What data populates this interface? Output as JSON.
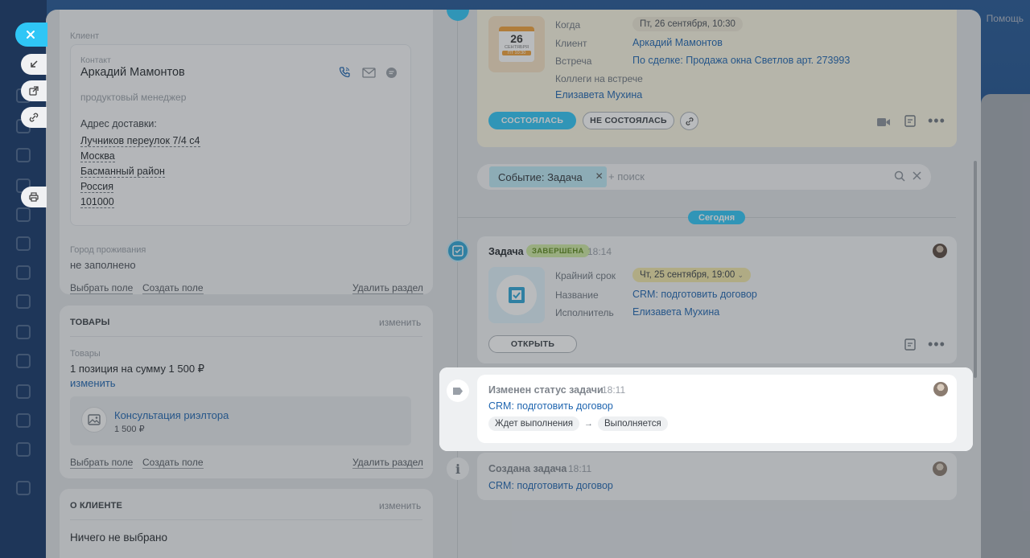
{
  "help_label": "Помощь",
  "client_section": {
    "title": "Клиент",
    "contact_label": "Контакт",
    "contact_name": "Аркадий Мамонтов",
    "contact_position": "продуктовый менеджер",
    "address_label": "Адрес доставки:",
    "address_lines": [
      "Лучников переулок 7/4 с4",
      "Москва",
      "Басманный район",
      "Россия",
      "101000"
    ],
    "city_label": "Город проживания",
    "city_value": "не заполнено",
    "select_field": "Выбрать поле",
    "create_field": "Создать поле",
    "delete_section": "Удалить раздел"
  },
  "goods_section": {
    "title": "ТОВАРЫ",
    "edit": "изменить",
    "goods_label": "Товары",
    "summary": "1 позиция на сумму 1 500 ₽",
    "change": "изменить",
    "product_name": "Консультация риэлтора",
    "product_price": "1 500 ₽",
    "select_field": "Выбрать поле",
    "create_field": "Создать поле",
    "delete_section": "Удалить раздел"
  },
  "about_section": {
    "title": "О КЛИЕНТЕ",
    "edit": "изменить",
    "value": "Ничего не выбрано"
  },
  "meeting": {
    "calendar_day": "26",
    "calendar_month": "СЕНТЯБРЯ",
    "calendar_time": "ПТ 10:30",
    "when_label": "Когда",
    "when_value": "Пт, 26 сентября, 10:30",
    "client_label": "Клиент",
    "client_value": "Аркадий Мамонтов",
    "meeting_label": "Встреча",
    "meeting_value": "По сделке: Продажа окна Светлов арт. 273993",
    "colleagues_label": "Коллеги на встрече",
    "colleagues_value": "Елизавета Мухина",
    "done_btn": "СОСТОЯЛАСЬ",
    "not_done_btn": "НЕ СОСТОЯЛАСЬ"
  },
  "filter": {
    "chip": "Событие: Задача",
    "placeholder": "+ поиск"
  },
  "today_badge": "Сегодня",
  "task": {
    "title": "Задача",
    "status": "ЗАВЕРШЕНА",
    "time": "18:14",
    "deadline_label": "Крайний срок",
    "deadline_value": "Чт, 25 сентября, 19:00",
    "name_label": "Название",
    "name_value": "CRM: подготовить договор",
    "assignee_label": "Исполнитель",
    "assignee_value": "Елизавета Мухина",
    "open_btn": "ОТКРЫТЬ"
  },
  "status_change": {
    "title": "Изменен статус задачи",
    "time": "18:11",
    "link": "CRM: подготовить договор",
    "from": "Ждет выполнения",
    "arrow": "→",
    "to": "Выполняется"
  },
  "task_created": {
    "title": "Создана задача",
    "time": "18:11",
    "link": "CRM: подготовить договор"
  },
  "colors": {
    "accent": "#2fc6f6",
    "link": "#2066b0",
    "success": "#bde673",
    "deadline": "#f4e7a8"
  }
}
